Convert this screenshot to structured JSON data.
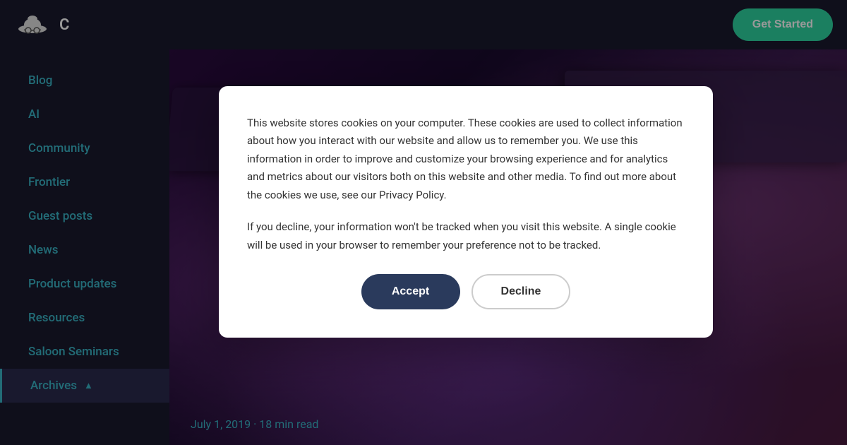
{
  "header": {
    "logo_alt": "Cowboy Hat Logo",
    "logo_text": "C",
    "get_started_label": "Get Started"
  },
  "sidebar": {
    "items": [
      {
        "id": "blog",
        "label": "Blog"
      },
      {
        "id": "ai",
        "label": "AI"
      },
      {
        "id": "community",
        "label": "Community"
      },
      {
        "id": "frontier",
        "label": "Frontier"
      },
      {
        "id": "guest-posts",
        "label": "Guest posts"
      },
      {
        "id": "news",
        "label": "News"
      },
      {
        "id": "product-updates",
        "label": "Product updates"
      },
      {
        "id": "resources",
        "label": "Resources"
      },
      {
        "id": "saloon-seminars",
        "label": "Saloon Seminars"
      }
    ],
    "archives_label": "Archives",
    "archives_icon": "▲"
  },
  "main": {
    "post_date": "July 1, 2019",
    "post_read_time": "18 min read",
    "post_date_separator": "·"
  },
  "cookie_modal": {
    "paragraph1": "This website stores cookies on your computer. These cookies are used to collect information about how you interact with our website and allow us to remember you. We use this information in order to improve and customize your browsing experience and for analytics and metrics about our visitors both on this website and other media. To find out more about the cookies we use, see our Privacy Policy.",
    "paragraph2": "If you decline, your information won't be tracked when you visit this website. A single cookie will be used in your browser to remember your preference not to be tracked.",
    "accept_label": "Accept",
    "decline_label": "Decline"
  },
  "colors": {
    "accent": "#3ab5c6",
    "sidebar_bg": "#1a1a2e",
    "get_started_bg": "#2dd4a0",
    "modal_accept_bg": "#2a3a5c"
  }
}
